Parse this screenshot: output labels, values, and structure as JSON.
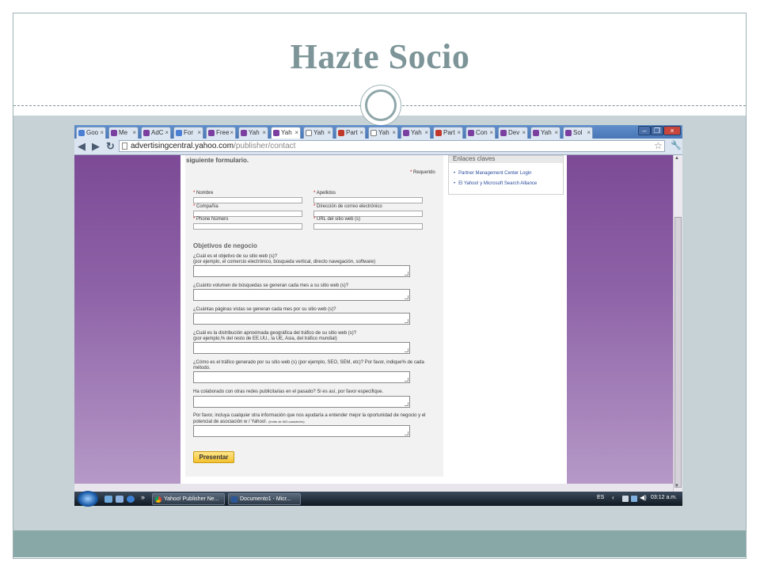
{
  "slide": {
    "title": "Hazte Socio"
  },
  "browser": {
    "tabs": [
      {
        "label": "Goo",
        "icon": "google-icon"
      },
      {
        "label": "Me",
        "icon": "yahoo-icon"
      },
      {
        "label": "AdC",
        "icon": "yahoo-icon"
      },
      {
        "label": "For",
        "icon": "arrow-icon"
      },
      {
        "label": "Free",
        "icon": "yahoo-icon"
      },
      {
        "label": "Yah",
        "icon": "yahoo-icon"
      },
      {
        "label": "Yah",
        "icon": "yahoo-icon",
        "active": true
      },
      {
        "label": "Yah",
        "icon": "page-icon"
      },
      {
        "label": "Part",
        "icon": "yahoo-icon"
      },
      {
        "label": "Yah",
        "icon": "printer-icon"
      },
      {
        "label": "Yah",
        "icon": "yahoo-icon"
      },
      {
        "label": "Part",
        "icon": "yahoo-icon"
      },
      {
        "label": "Con",
        "icon": "yahoo-icon"
      },
      {
        "label": "Dev",
        "icon": "yahoo-icon"
      },
      {
        "label": "Yah",
        "icon": "yahoo-icon"
      },
      {
        "label": "Sol",
        "icon": "yahoo-icon"
      }
    ],
    "address": {
      "domain": "advertisingcentral.yahoo.com",
      "path": "/publisher/contact"
    },
    "window_controls": {
      "minimize": "–",
      "maximize": "❐",
      "close": "×"
    }
  },
  "page": {
    "intro": "siguiente formulario.",
    "required_note": "Requerido",
    "fields": {
      "nombre": "Nombre",
      "apellidos": "Apellidos",
      "compania": "Compañía",
      "email": "Dirección de correo electrónico",
      "phone": "Phone Número",
      "url": "URL del sitio web (s)"
    },
    "section_title": "Objetivos de negocio",
    "questions": [
      {
        "text": "¿Cuál es el objetivo de su sitio web (s)?",
        "hint": "(por ejemplo, el comercio electrónico, búsqueda vertical, directo navegación, software)"
      },
      {
        "text": "¿Cuánto volumen de búsquedas se generan cada mes a su sitio web (s)?",
        "hint": ""
      },
      {
        "text": "¿Cuántas páginas vistas se generan cada mes por su sitio web (s)?",
        "hint": ""
      },
      {
        "text": "¿Cuál es la distribución aproximada geográfica del tráfico de su sitio web (s)?",
        "hint": "(por ejemplo,% del resto de EE.UU., la UE, Asia, del tráfico mundial)"
      },
      {
        "text": "¿Cómo es el tráfico generado por su sitio web (s) (por ejemplo, SEO, SEM, etc)? Por favor, indique% de cada método.",
        "hint": ""
      },
      {
        "text": "Ha colaborado con otras redes publicitarias en el pasado? Si es así, por favor especifique.",
        "hint": ""
      },
      {
        "text": "Por favor, incluya cualquier otra información que nos ayudaría a entender mejor la oportunidad de negocio y el potencial de asociación w / Yahoo!.",
        "hint": "(límite de 500 caracteres)"
      }
    ],
    "submit_label": "Presentar",
    "sidebar": {
      "title": "Enlaces claves",
      "links": [
        "Partner Management Center Login",
        "El Yahoo! y Microsoft Search Alliance"
      ]
    }
  },
  "taskbar": {
    "windows": [
      {
        "label": "Yahoo! Publisher Ne...",
        "icon": "chrome-icon"
      },
      {
        "label": "Documento1 - Micr...",
        "icon": "word-icon"
      }
    ],
    "lang": "ES",
    "clock": "03:12 a.m."
  }
}
